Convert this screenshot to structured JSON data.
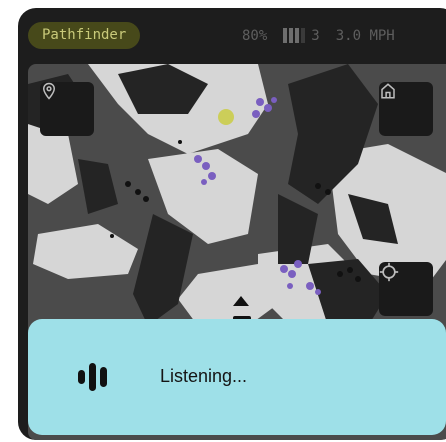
{
  "app": {
    "title": "Pathfinder"
  },
  "status": {
    "battery": "80%",
    "signal_bars": 3,
    "signal_count": "3",
    "speed": "3.0 MPH"
  },
  "map": {
    "buttons": [
      {
        "icon": "location-pin-icon"
      },
      {
        "icon": "home-icon"
      },
      {
        "icon": "crosshair-icon"
      }
    ],
    "robot_icon": "robot-icon",
    "heading_icon": "heading-arrow-icon"
  },
  "voice": {
    "status_text": "Listening...",
    "icon": "voice-waveform-icon"
  },
  "colors": {
    "app_pill_bg": "#47491a",
    "app_pill_text": "#c9ca7a",
    "panel_bg": "#9ee0e8",
    "device_bg": "#1d1d1d"
  }
}
